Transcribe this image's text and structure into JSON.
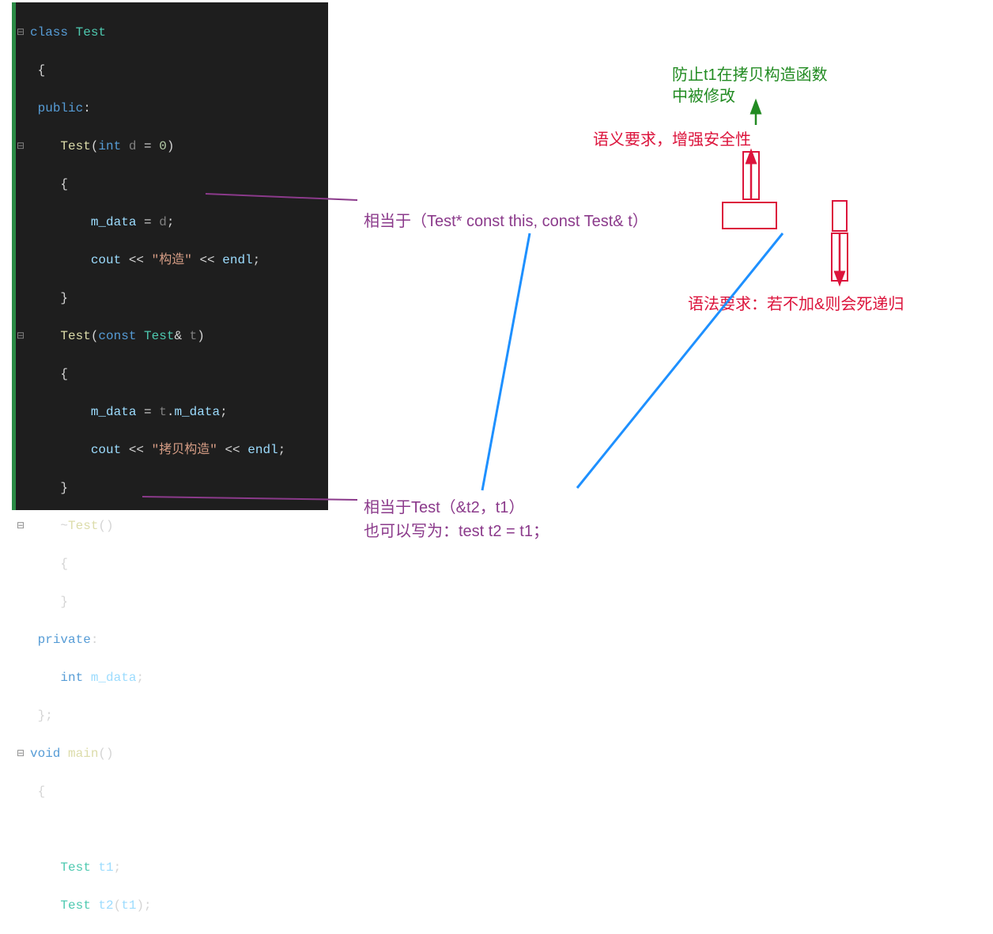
{
  "code": {
    "line1": {
      "kw": "class",
      "cls": " Test"
    },
    "line2": "{",
    "line3": {
      "kw": "public",
      "punct": ":"
    },
    "line4": {
      "indent": "    ",
      "func": "Test",
      "open": "(",
      "kw2": "int",
      "sp": " ",
      "param": "d",
      "eq": " = ",
      "num": "0",
      "close": ")"
    },
    "line5": {
      "indent": "    ",
      "brace": "{"
    },
    "line6": {
      "indent": "        ",
      "var1": "m_data",
      "eq": " = ",
      "var2": "d",
      "semi": ";"
    },
    "line7": {
      "indent": "        ",
      "var1": "cout",
      "op1": " << ",
      "str": "\"构造\"",
      "op2": " << ",
      "var2": "endl",
      "semi": ";"
    },
    "line8": {
      "indent": "    ",
      "brace": "}"
    },
    "line9": {
      "indent": "    ",
      "func": "Test",
      "open": "(",
      "kw2": "const",
      "sp1": " ",
      "cls": "Test",
      "amp": "& ",
      "param": "t",
      "close": ")"
    },
    "line10": {
      "indent": "    ",
      "brace": "{"
    },
    "line11": {
      "indent": "        ",
      "var1": "m_data",
      "eq": " = ",
      "var2": "t",
      "dot": ".",
      "var3": "m_data",
      "semi": ";"
    },
    "line12": {
      "indent": "        ",
      "var1": "cout",
      "op1": " << ",
      "str": "\"拷贝构造\"",
      "op2": " << ",
      "var2": "endl",
      "semi": ";"
    },
    "line13": {
      "indent": "    ",
      "brace": "}"
    },
    "line14": {
      "indent": "    ",
      "tilde": "~",
      "func": "Test",
      "parens": "()"
    },
    "line15": {
      "indent": "    ",
      "brace": "{"
    },
    "line16": {
      "indent": "    ",
      "brace": "}"
    },
    "line17": {
      "kw": "private",
      "punct": ":"
    },
    "line18": {
      "indent": "    ",
      "kw": "int",
      "sp": " ",
      "var": "m_data",
      "semi": ";"
    },
    "line19": "};",
    "line20": {
      "kw": "void",
      "sp": " ",
      "func": "main",
      "parens": "()"
    },
    "line21": "{",
    "line22": {
      "indent": "    ",
      "cls": "Test",
      "sp": " ",
      "var": "t1",
      "semi": ";"
    },
    "line23": {
      "indent": "    ",
      "cls": "Test",
      "sp": " ",
      "var": "t2",
      "open": "(",
      "arg": "t1",
      "close": ")",
      "semi": ";"
    }
  },
  "annotations": {
    "green1": "防止t1在拷贝构造函数",
    "green2": "中被修改",
    "red1": "语义要求，增强安全性",
    "purple1": "相当于（Test* const this, const Test& t）",
    "red2": "语法要求：若不加&则会死递归",
    "purple2a": "相当于Test（&t2，t1）",
    "purple2b": "也可以写为：test t2 = t1；"
  },
  "colors": {
    "green": "#228b22",
    "red": "#dc143c",
    "purple": "#8b3a8b",
    "blue": "#1e90ff"
  }
}
